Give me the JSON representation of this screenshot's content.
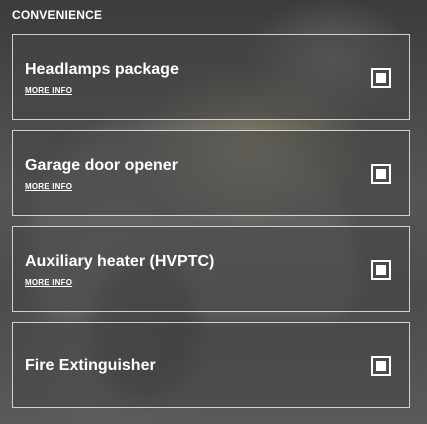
{
  "section": {
    "title": "CONVENIENCE"
  },
  "options": [
    {
      "title": "Headlamps package",
      "more_info": "MORE INFO",
      "checked": true
    },
    {
      "title": "Garage door opener",
      "more_info": "MORE INFO",
      "checked": true
    },
    {
      "title": "Auxiliary heater (HVPTC)",
      "more_info": "MORE INFO",
      "checked": true
    },
    {
      "title": "Fire Extinguisher",
      "more_info": "",
      "checked": true
    }
  ],
  "colors": {
    "text": "#ffffff",
    "border": "#ffffff"
  }
}
